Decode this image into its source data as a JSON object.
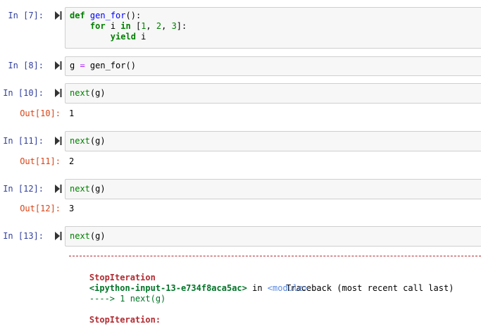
{
  "cells": [
    {
      "in_prompt": "In [7]:",
      "lines": [
        [
          {
            "t": "def",
            "c": "kw"
          },
          {
            "t": " "
          },
          {
            "t": "gen_for",
            "c": "fn"
          },
          {
            "t": "():"
          }
        ],
        [
          {
            "t": "    "
          },
          {
            "t": "for",
            "c": "kw"
          },
          {
            "t": " i "
          },
          {
            "t": "in",
            "c": "kw"
          },
          {
            "t": " ["
          },
          {
            "t": "1",
            "c": "num"
          },
          {
            "t": ", "
          },
          {
            "t": "2",
            "c": "num"
          },
          {
            "t": ", "
          },
          {
            "t": "3",
            "c": "num"
          },
          {
            "t": "]:"
          }
        ],
        [
          {
            "t": "        "
          },
          {
            "t": "yield",
            "c": "kw"
          },
          {
            "t": " i"
          }
        ]
      ]
    },
    {
      "in_prompt": "In [8]:",
      "lines": [
        [
          {
            "t": "g "
          },
          {
            "t": "=",
            "c": "op"
          },
          {
            "t": " gen_for()"
          }
        ]
      ]
    },
    {
      "in_prompt": "In [10]:",
      "lines": [
        [
          {
            "t": "next",
            "c": "bi"
          },
          {
            "t": "(g)"
          }
        ]
      ],
      "out_prompt": "Out[10]:",
      "output": "1"
    },
    {
      "in_prompt": "In [11]:",
      "lines": [
        [
          {
            "t": "next",
            "c": "bi"
          },
          {
            "t": "(g)"
          }
        ]
      ],
      "out_prompt": "Out[11]:",
      "output": "2"
    },
    {
      "in_prompt": "In [12]:",
      "lines": [
        [
          {
            "t": "next",
            "c": "bi"
          },
          {
            "t": "(g)"
          }
        ]
      ],
      "out_prompt": "Out[12]:",
      "output": "3"
    },
    {
      "in_prompt": "In [13]:",
      "lines": [
        [
          {
            "t": "next",
            "c": "bi"
          },
          {
            "t": "(g)"
          }
        ]
      ]
    }
  ],
  "traceback": {
    "dashes": "----------------------------------------------------------------------",
    "error_name": "StopIteration",
    "header_right": "Traceback (most recent call last)",
    "input_ref": "<ipython-input-13-e734f8aca5ac>",
    "in_word": " in ",
    "module": "<module>",
    "arrow_line": "----> 1 next(g)",
    "final_error": "StopIteration:"
  },
  "colors": {
    "in_prompt": "#303f9f",
    "out_prompt": "#d84315",
    "keyword": "#008000",
    "error": "#b22b31"
  },
  "icons": {
    "run": "run-cell-icon"
  }
}
